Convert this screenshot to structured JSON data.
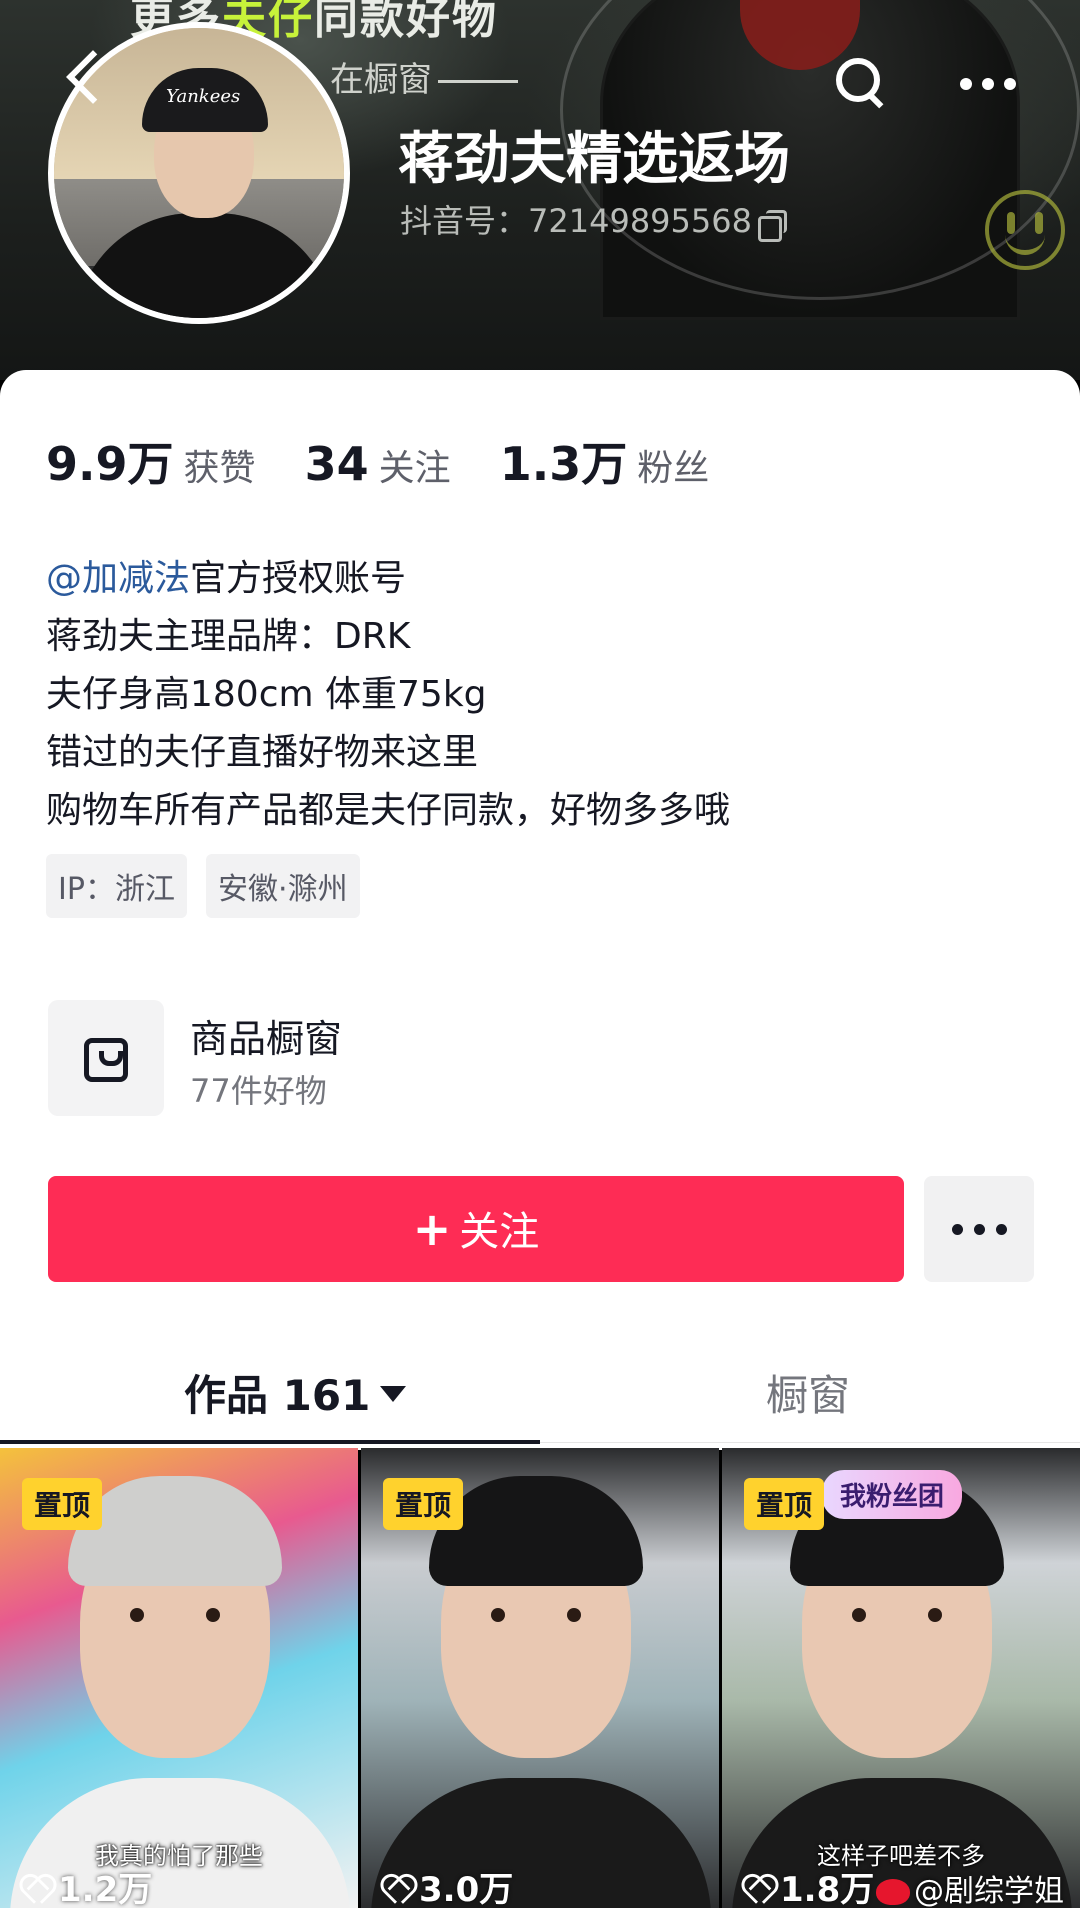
{
  "header": {
    "banner_text_a": "更多",
    "banner_text_b": "夫仔",
    "banner_text_c": "同款好物",
    "banner_sub": "在橱窗",
    "name": "蒋劲夫精选返场",
    "account_label": "抖音号：",
    "account_id": "72149895568",
    "cap_text": "Yankees"
  },
  "stats": {
    "likes_num": "9.9万",
    "likes_label": "获赞",
    "following_num": "34",
    "following_label": "关注",
    "followers_num": "1.3万",
    "followers_label": "粉丝"
  },
  "bio": {
    "mention": "@加减法",
    "line1_rest": "官方授权账号",
    "line2": "蒋劲夫主理品牌：DRK",
    "line3": "夫仔身高180cm 体重75kg",
    "line4": "错过的夫仔直播好物来这里",
    "line5": "购物车所有产品都是夫仔同款，好物多多哦"
  },
  "tags": [
    "IP：浙江",
    "安徽·滁州"
  ],
  "shop": {
    "title": "商品橱窗",
    "subtitle": "77件好物"
  },
  "actions": {
    "follow_plus": "+",
    "follow_label": "关注"
  },
  "tabs": {
    "works_label": "作品 161",
    "shop_label": "橱窗"
  },
  "videos": [
    {
      "pin": "置顶",
      "caption": "我真的怕了那些",
      "likes": "1.2万"
    },
    {
      "pin": "置顶",
      "caption": "",
      "likes": "3.0万"
    },
    {
      "pin": "置顶",
      "badge": "我粉丝团",
      "caption": "这样子吧差不多",
      "likes": "1.8万"
    }
  ],
  "watermark": "@剧综学姐",
  "colors": {
    "accent": "#fe2c55",
    "pin_badge": "#ffd22d",
    "mention": "#2b5a9c"
  }
}
